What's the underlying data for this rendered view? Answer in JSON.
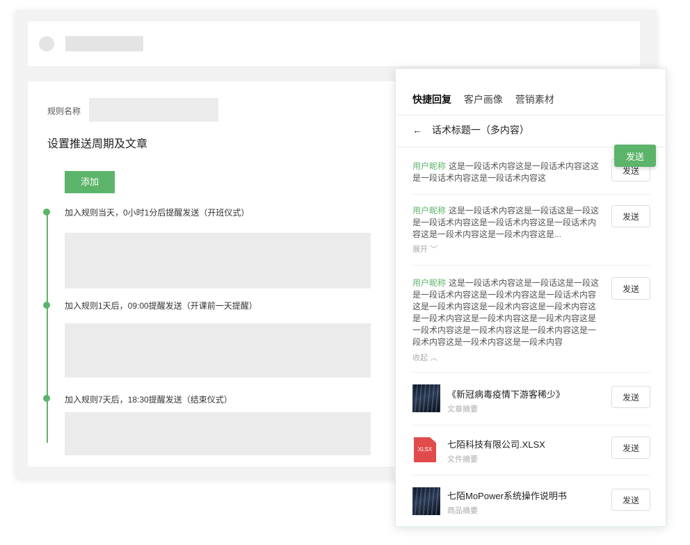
{
  "main": {
    "rule_label": "规则名称",
    "section_title": "设置推送周期及文章",
    "add_label": "添加",
    "steps": [
      {
        "text": "加入规则当天，0小时1分后提醒发送（开班仪式）"
      },
      {
        "text": "加入规则1天后，09:00提醒发送（开课前一天提醒）"
      },
      {
        "text": "加入规则7天后，18:30提醒发送（结束仪式）"
      }
    ]
  },
  "panel": {
    "tabs": [
      "快捷回复",
      "客户画像",
      "营销素材"
    ],
    "back_title": "话术标题一（多内容）",
    "send_label": "发送",
    "messages": [
      {
        "nick": "用户昵称",
        "text": "这是一段话术内容这是一段话术内容这这是一段话术内容这是一段话术内容这"
      },
      {
        "nick": "用户昵称",
        "text": "这是一段话术内容这是一段话这是一段这是一段话术内容这是一段话术内容这是一段话术内容这是一段术内容这是一段术内容这是...",
        "toggle": "展开"
      },
      {
        "nick": "用户昵称",
        "text": "这是一段话术内容这是一段话这是一段这是一段话术内容这是一段术内容这是一段话术内容这是一段术内容这是一段术内容这是一段术内容这是一段术内容这是一段术内容这是一段术内容这是一段术内容这是一段术内容这是一段术内容这是一段术内容这是一段术内容这是一段术内容",
        "toggle": "收起"
      }
    ],
    "items": [
      {
        "title": "《新冠病毒疫情下游客稀少》",
        "sub": "文章摘要"
      },
      {
        "title": "七陌科技有限公司.XLSX",
        "sub": "文件摘要",
        "file_badge": "XLSX"
      },
      {
        "title": "七陌MoPower系统操作说明书",
        "sub": "商品摘要"
      }
    ]
  },
  "colors": {
    "accent": "#5cb46a",
    "file_red": "#e24b4b"
  },
  "icons": [
    "back-arrow-icon",
    "chevron-down-icon",
    "chevron-up-icon",
    "xlsx-file-icon"
  ]
}
